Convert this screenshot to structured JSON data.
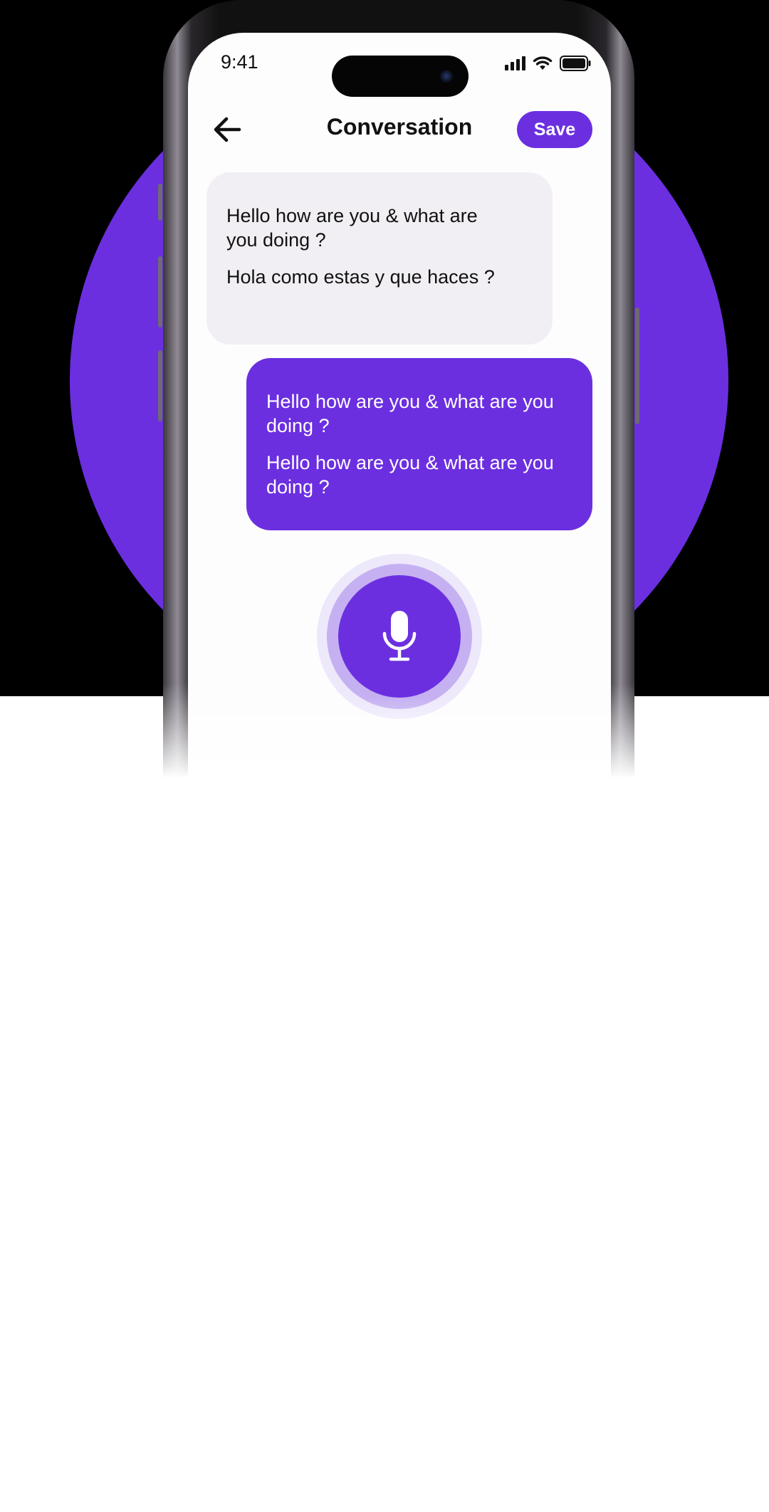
{
  "status_bar": {
    "time": "9:41",
    "icons": [
      "signal-icon",
      "wifi-icon",
      "battery-icon"
    ]
  },
  "header": {
    "back_icon": "arrow-left-icon",
    "title": "Conversation",
    "save_label": "Save"
  },
  "messages": [
    {
      "direction": "incoming",
      "original": "Hello how are you & what are you doing ?",
      "translation": "Hola como estas y que haces ?"
    },
    {
      "direction": "outgoing",
      "original": "Hello how are you & what are you doing ?",
      "translation": "Hello how are you & what are you doing ?"
    }
  ],
  "mic_button": {
    "icon": "microphone-icon"
  },
  "colors": {
    "accent": "#6b2fe0",
    "incoming_bubble": "#f1eff3",
    "mic_ring_outer": "#eee8fb",
    "mic_ring_mid": "#c5b1f1",
    "backdrop": "#000000"
  }
}
